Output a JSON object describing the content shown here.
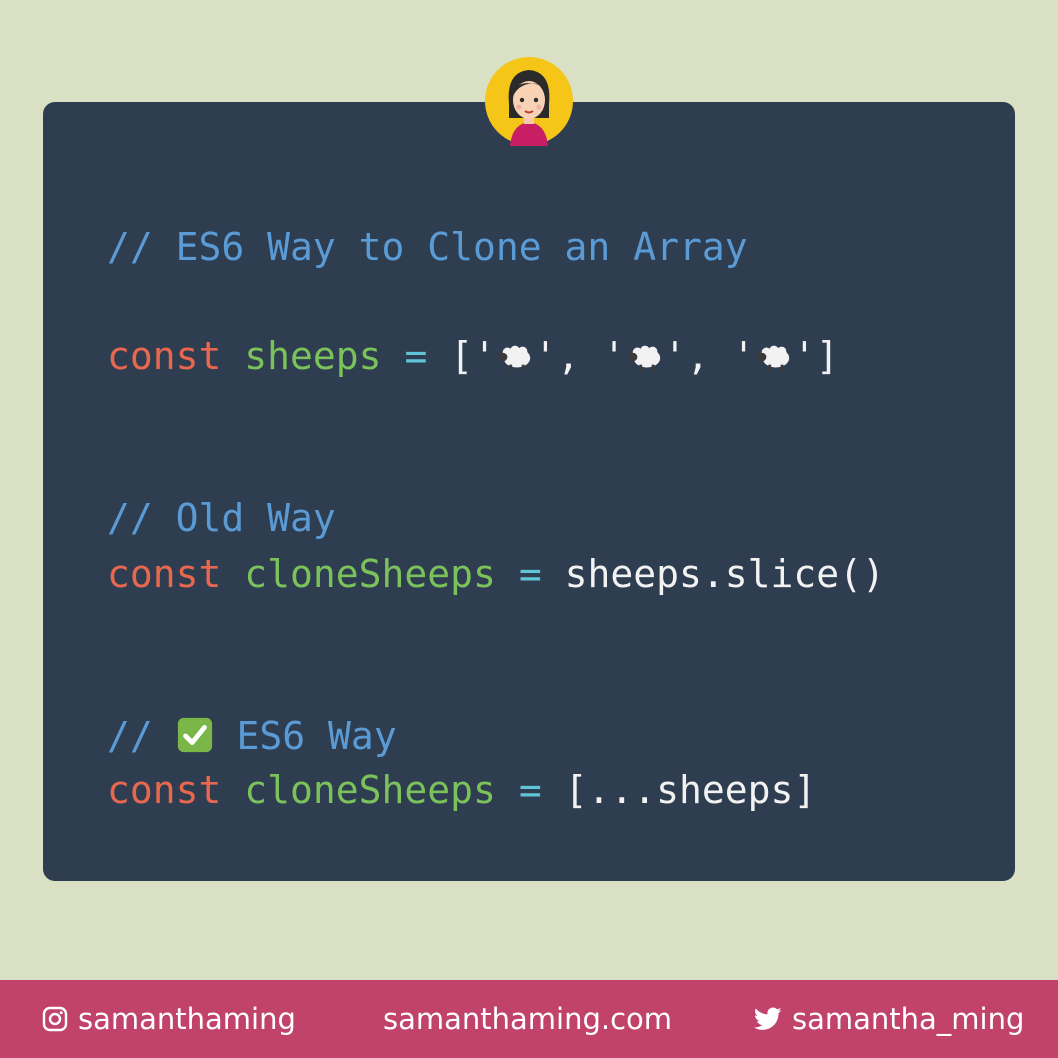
{
  "colors": {
    "background": "#dae0c4",
    "card": "#2e3d50",
    "comment": "#5b9bd5",
    "keyword": "#e8674e",
    "variable": "#7bc15c",
    "operator": "#5fc4d6",
    "plain": "#f2f2f2",
    "footer": "#c1426a"
  },
  "avatar": {
    "icon": "girl-avatar-icon"
  },
  "code": {
    "comment1": "// ES6 Way to Clone an Array",
    "line1": {
      "kw": "const",
      "var": "sheeps",
      "op": "=",
      "open": "['",
      "sep1": "', '",
      "sep2": "', '",
      "close": "']",
      "item_icon": "sheep-icon"
    },
    "comment2": "// Old Way",
    "line2": {
      "kw": "const",
      "var": "cloneSheeps",
      "op": "=",
      "value": "sheeps.slice()"
    },
    "comment3_prefix": "//",
    "comment3_icon": "check-mark-icon",
    "comment3_text": "ES6 Way",
    "line3": {
      "kw": "const",
      "var": "cloneSheeps",
      "op": "=",
      "value": "[...sheeps]"
    }
  },
  "footer": {
    "instagram_icon": "instagram-icon",
    "instagram": "samanthaming",
    "website": "samanthaming.com",
    "twitter_icon": "twitter-icon",
    "twitter": "samantha_ming"
  }
}
